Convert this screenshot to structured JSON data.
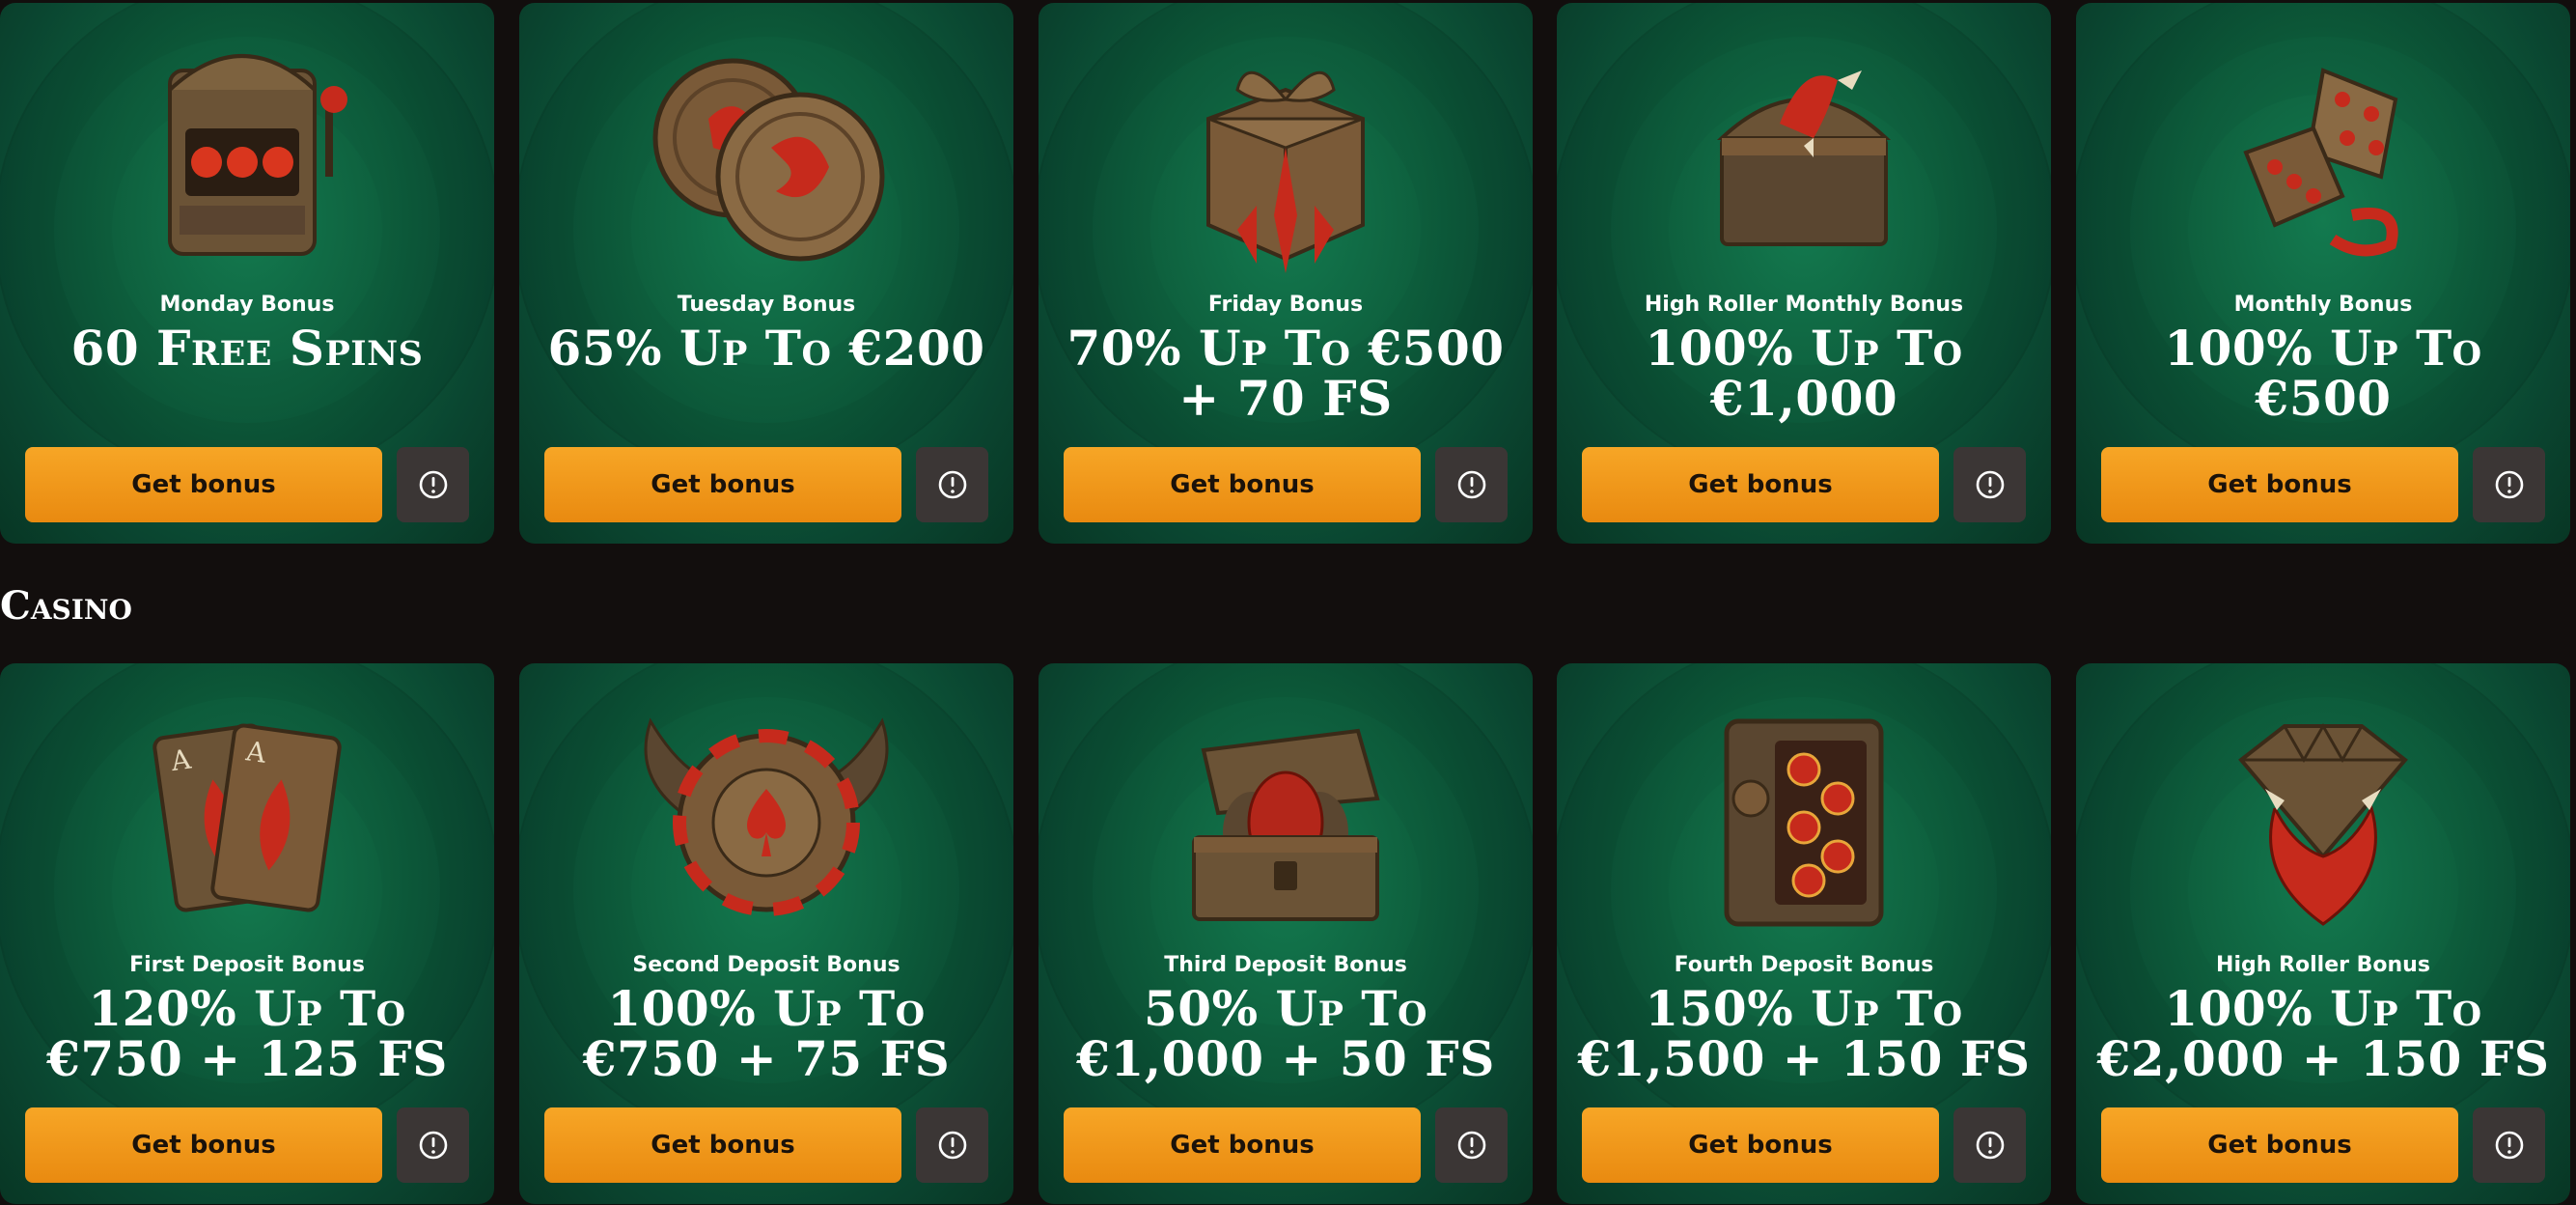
{
  "promo_row": [
    {
      "label": "Monday Bonus",
      "headline": "60 Free Spins",
      "button": "Get bonus",
      "icon": "slot-machine-icon"
    },
    {
      "label": "Tuesday Bonus",
      "headline": "65% Up To €200",
      "button": "Get bonus",
      "icon": "dragon-coins-icon"
    },
    {
      "label": "Friday Bonus",
      "headline": "70% Up To €500 + 70 FS",
      "button": "Get bonus",
      "icon": "gift-box-icon"
    },
    {
      "label": "High Roller Monthly Bonus",
      "headline": "100% Up To €1,000",
      "button": "Get bonus",
      "icon": "treasure-chest-claw-icon"
    },
    {
      "label": "Monthly Bonus",
      "headline": "100% Up To €500",
      "button": "Get bonus",
      "icon": "dice-icon"
    }
  ],
  "casino_section": {
    "title": "Casino",
    "cards": [
      {
        "label": "First Deposit Bonus",
        "headline": "120% Up To €750 + 125 FS",
        "button": "Get bonus",
        "icon": "playing-cards-icon"
      },
      {
        "label": "Second Deposit Bonus",
        "headline": "100% Up To €750 + 75 FS",
        "button": "Get bonus",
        "icon": "winged-chip-icon"
      },
      {
        "label": "Third Deposit Bonus",
        "headline": "50% Up To €1,000 + 50 FS",
        "button": "Get bonus",
        "icon": "egg-chest-icon"
      },
      {
        "label": "Fourth Deposit Bonus",
        "headline": "150% Up To €1,500 + 150 FS",
        "button": "Get bonus",
        "icon": "safe-icon"
      },
      {
        "label": "High Roller Bonus",
        "headline": "100% Up To €2,000 + 150 FS",
        "button": "Get bonus",
        "icon": "diamond-claw-icon"
      }
    ]
  },
  "colors": {
    "page_bg": "#120e0d",
    "card_green": "#0e5f3d",
    "button_orange": "#f29a1c",
    "info_button": "#3b3635",
    "accent_red": "#c62a1c",
    "bronze": "#8a6a44"
  }
}
